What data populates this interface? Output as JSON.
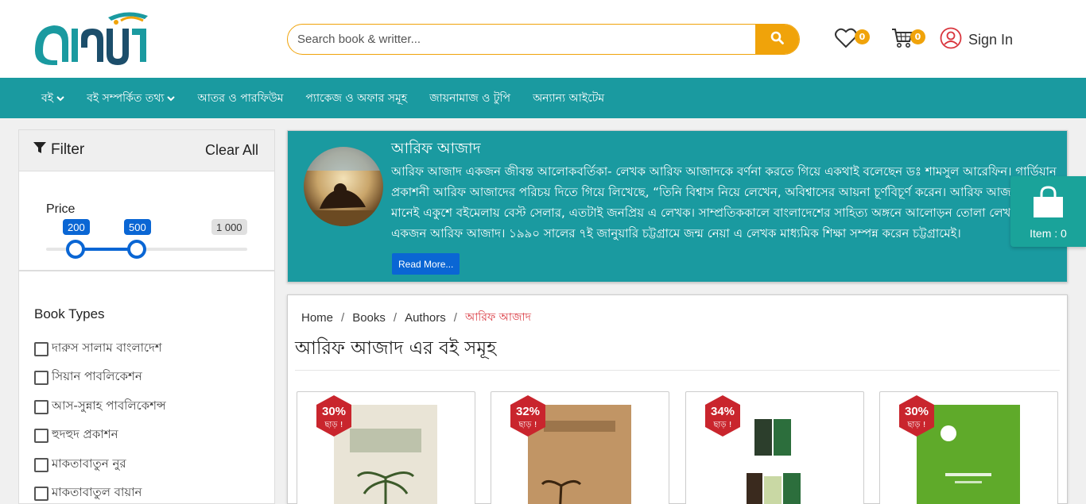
{
  "header": {
    "logo_text": "আইমান",
    "search_placeholder": "Search book & writter...",
    "wishlist_count": "0",
    "cart_count": "0",
    "signin_label": "Sign In"
  },
  "nav": {
    "items": [
      {
        "label": "বই",
        "dropdown": true
      },
      {
        "label": "বই সম্পর্কিত তথ্য",
        "dropdown": true
      },
      {
        "label": "আতর ও পারফিউম",
        "dropdown": false
      },
      {
        "label": "প্যাকেজ ও অফার সমূহ",
        "dropdown": false
      },
      {
        "label": "জায়নামাজ ও টুপি",
        "dropdown": false
      },
      {
        "label": "অন্যান্য আইটেম",
        "dropdown": false
      }
    ]
  },
  "filter": {
    "title": "Filter",
    "clear_label": "Clear All",
    "price_label": "Price",
    "price_min": "200",
    "price_max": "500",
    "price_limit": "1 000",
    "book_types_title": "Book Types",
    "book_types": [
      "দারুস সালাম বাংলাদেশ",
      "সিয়ান পাবলিকেশন",
      "আস-সুন্নাহ পাবলিকেশন্স",
      "হুদহুদ প্রকাশন",
      "মাকতাবাতুন নুর",
      "মাকতাবাতুল বায়ান"
    ]
  },
  "author": {
    "name": "আরিফ আজাদ",
    "bio": "আরিফ আজাদ একজন জীবন্ত আলোকবর্তিকা- লেখক আরিফ আজাদকে বর্ণনা করতে গিয়ে একথাই বলেছেন ডঃ শামসুল আরেফিন। গার্ডিয়ান প্রকাশনী আরিফ আজাদের পরিচয় দিতে গিয়ে লিখেছে, “তিনি বিশ্বাস নিয়ে লেখেন, অবিশ্বাসের আয়না চূর্ণবিচূর্ণ করেন। আরিফ আজাদ এর বই মানেই একুশে বইমেলায় বেস্ট সেলার, এতটাই জনপ্রিয় এ লেখক। সাম্প্রতিককালে বাংলাদেশের সাহিত্য অঙ্গনে আলোড়ন তোলা লেখকদের একজন আরিফ আজাদ। ১৯৯০ সালের ৭ই জানুয়ারি চট্টগ্রামে জন্ম নেয়া এ লেখক মাধ্যমিক শিক্ষা সম্পন্ন করেন চট্টগ্রামেই।",
    "read_more_label": "Read More..."
  },
  "cart_float": {
    "label": "Item : 0"
  },
  "breadcrumb": {
    "items": [
      "Home",
      "Books",
      "Authors"
    ],
    "active": "আরিফ আজাদ"
  },
  "page_title": "আরিফ আজাদ এর বই সমূহ",
  "books": [
    {
      "discount": "30%",
      "off_label": "ছাড় !",
      "cover_color": "#e9e4d6",
      "accent": "#3c5a2a"
    },
    {
      "discount": "32%",
      "off_label": "ছাড় !",
      "cover_color": "#b88a5c",
      "accent": "#5a3a1e"
    },
    {
      "discount": "34%",
      "off_label": "ছাড় !",
      "cover_color": "#ffffff",
      "accent": "#2c6e3c"
    },
    {
      "discount": "30%",
      "off_label": "ছাড় !",
      "cover_color": "#5faa2a",
      "accent": "#ffffff"
    }
  ],
  "colors": {
    "teal": "#1a9aa0",
    "orange": "#f0a30a",
    "blue": "#0a66d4",
    "red": "#d9363e"
  }
}
